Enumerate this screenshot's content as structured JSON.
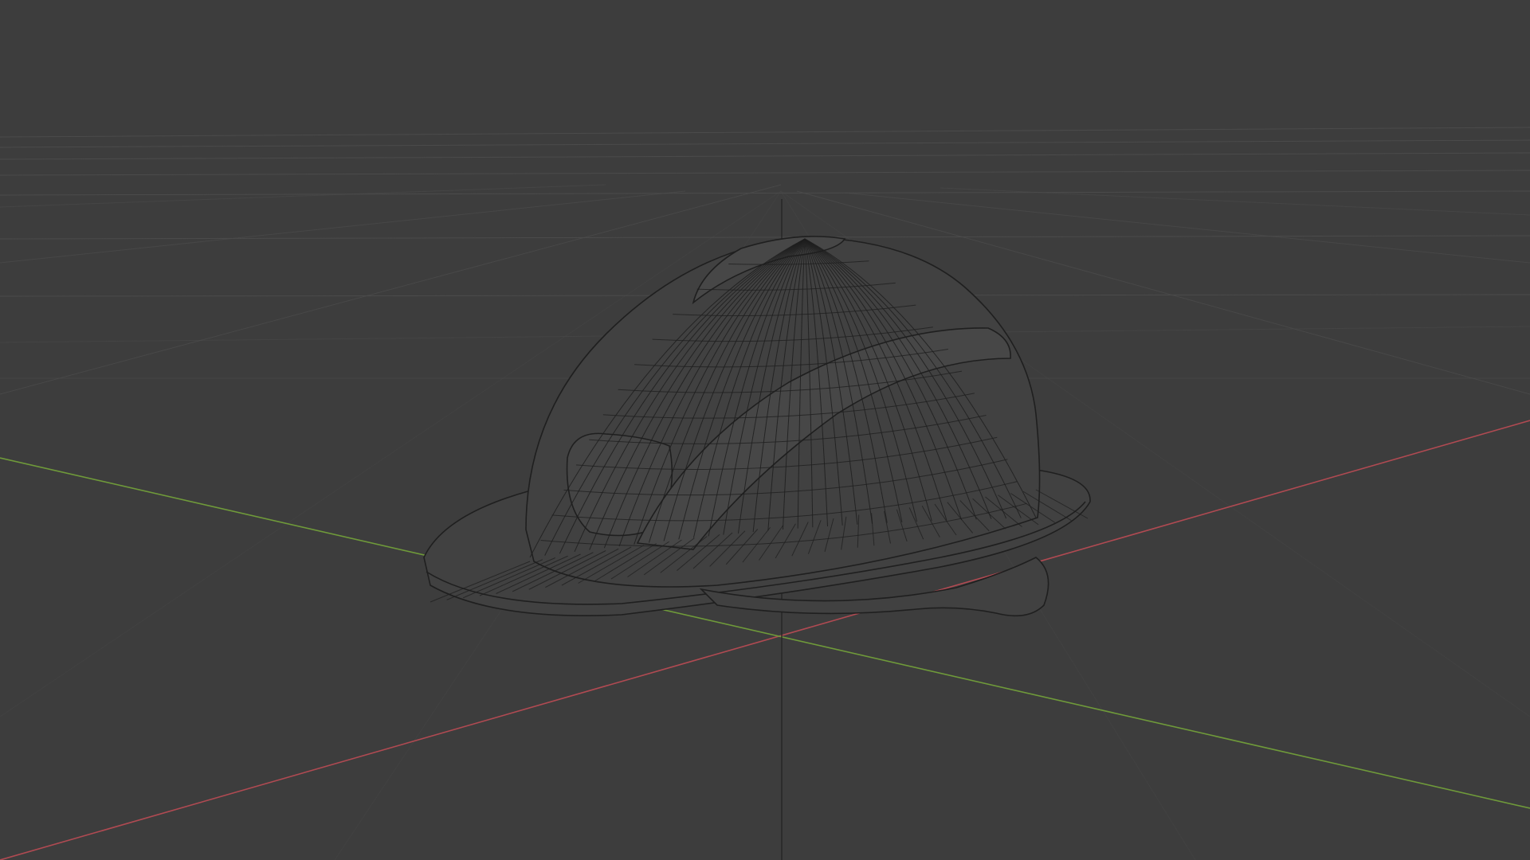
{
  "viewport": {
    "background": "#3d3d3d",
    "grid_color": "#4a4a4a",
    "axis_x_color": "#b04a52",
    "axis_y_color": "#6f9a3a",
    "axis_z_color": "#2a2a2a",
    "wire_color": "#1f1f1f",
    "shade_color": "#414141"
  },
  "scene": {
    "object_icon": "helmet-wireframe",
    "display_mode": "wireframe"
  }
}
